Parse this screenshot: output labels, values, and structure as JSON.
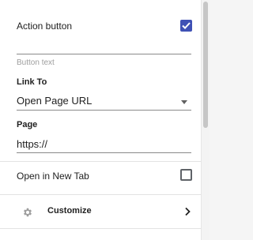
{
  "fields": {
    "action_button": {
      "label": "Action button",
      "checked": true
    },
    "button_text": {
      "label": "Button text",
      "value": ""
    },
    "link_to": {
      "label": "Link To",
      "value": "Open Page URL"
    },
    "page": {
      "label": "Page",
      "value": "https://"
    },
    "open_in_new_tab": {
      "label": "Open in New Tab",
      "checked": false
    }
  },
  "customize": {
    "label": "Customize"
  },
  "icons": {
    "check": "check-icon",
    "dropdown": "caret-down-icon",
    "settings": "gear-icon",
    "expand": "chevron-right-icon"
  },
  "colors": {
    "accent": "#3f51b5",
    "text": "#212121",
    "muted": "#9e9e9e"
  }
}
